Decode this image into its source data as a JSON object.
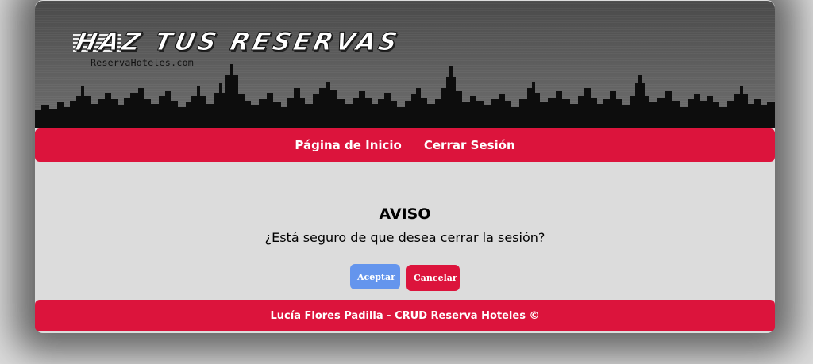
{
  "header": {
    "title": "HAZ TUS RESERVAS",
    "subtitle": "ReservaHoteles.com"
  },
  "nav": {
    "items": [
      {
        "label": "Página de Inicio"
      },
      {
        "label": "Cerrar Sesión"
      }
    ]
  },
  "dialog": {
    "title": "AVISO",
    "message": "¿Está seguro de que desea cerrar la sesión?",
    "accept_label": "Aceptar",
    "cancel_label": "Cancelar"
  },
  "footer": {
    "text": "Lucía Flores Padilla - CRUD Reserva Hoteles ©"
  },
  "colors": {
    "primary": "#dc143c",
    "accept": "#6495ed",
    "background": "#dcdcdc"
  }
}
